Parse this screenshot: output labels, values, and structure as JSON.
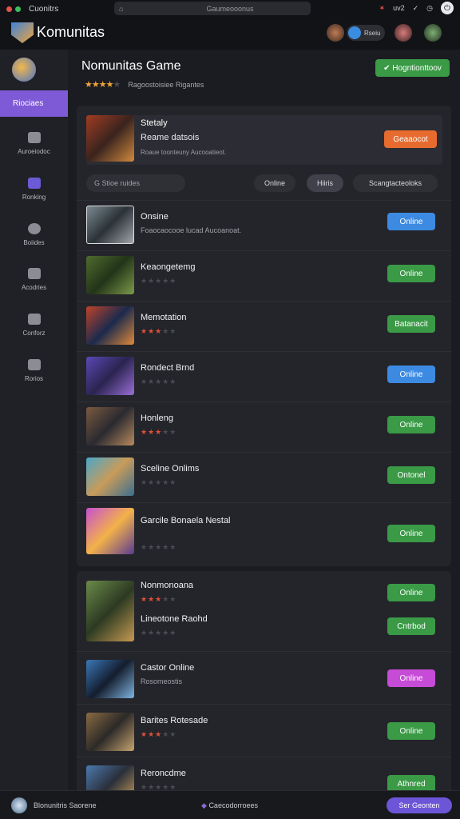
{
  "titlebar": {
    "title": "Cuonitrs",
    "search_text": "Gaumeooonus",
    "tray_text": "uv2"
  },
  "header": {
    "brand": "Komunitas",
    "badge_label": "Rseiu"
  },
  "sidebar": {
    "active_label": "Riociaes",
    "items": [
      {
        "label": "Auroeiodoc",
        "icon": "box-icon",
        "color": "#8c8c95"
      },
      {
        "label": "Ronking",
        "icon": "chat-icon",
        "color": "#6c5bd6"
      },
      {
        "label": "Boiides",
        "icon": "globe-icon",
        "color": "#8c8c95"
      },
      {
        "label": "Acodries",
        "icon": "camera-icon",
        "color": "#8c8c95"
      },
      {
        "label": "Conforz",
        "icon": "stack-icon",
        "color": "#8c8c95"
      },
      {
        "label": "Rorios",
        "icon": "puzzle-icon",
        "color": "#8c8c95"
      }
    ]
  },
  "main": {
    "title": "Nomunitas Game",
    "rating_text": "Ragoostoisiee  Rigantes",
    "top_button": "✔ Hogntionttoov",
    "featured": {
      "title": "Stetaly",
      "subtitle": "Reame datsois",
      "meta": "Roaue toonteuny Aucooatieot.",
      "button": "Geaaocot"
    },
    "search_placeholder": "G  Stioe ruides",
    "chips": [
      "Online",
      "Hiiris",
      "Scangtacteoloks"
    ],
    "games": [
      {
        "title": "Onsine",
        "meta": "Foaocaocooe lucad Aucoanoat.",
        "rating": 0,
        "button": "Online",
        "color": "#3d8ae3"
      },
      {
        "title": "Keaongetemg",
        "meta": "",
        "rating": 0,
        "button": "Online",
        "color": "#3a9a46"
      },
      {
        "title": "Memotation",
        "meta": "",
        "rating": 3,
        "button": "Batanacit",
        "color": "#3a9a46"
      },
      {
        "title": "Rondect Brnd",
        "meta": "",
        "rating": 0,
        "button": "Online",
        "color": "#3d8ae3"
      },
      {
        "title": "Honleng",
        "meta": "",
        "rating": 3,
        "button": "Online",
        "color": "#3a9a46"
      },
      {
        "title": "Sceline Onlims",
        "meta": "",
        "rating": 0,
        "button": "Ontonel",
        "color": "#3a9a46"
      },
      {
        "title": "Garcile Bonaela Nestal",
        "meta": "",
        "rating": 0,
        "button": "Online",
        "color": "#3a9a46"
      }
    ],
    "games2": [
      {
        "title": "Nonmonoana",
        "rating": 3,
        "button": "Online",
        "color": "#3a9a46"
      },
      {
        "title": "Lineotone Raohd",
        "rating": 0,
        "button": "Cntrbod",
        "color": "#3a9a46"
      },
      {
        "title": "Castor Online",
        "rating": 0,
        "meta": "Rosomeostis",
        "button": "Online",
        "color": "#c64bd6"
      },
      {
        "title": "Barites Rotesade",
        "rating": 3,
        "button": "Online",
        "color": "#3a9a46"
      },
      {
        "title": "Reroncdme",
        "rating": 0,
        "button": "Athnred",
        "color": "#3a9a46"
      }
    ]
  },
  "bottombar": {
    "left_text": "Blonunitris  Saorene",
    "center_text": "Caecodorroees",
    "button": "Ser Geonten"
  }
}
